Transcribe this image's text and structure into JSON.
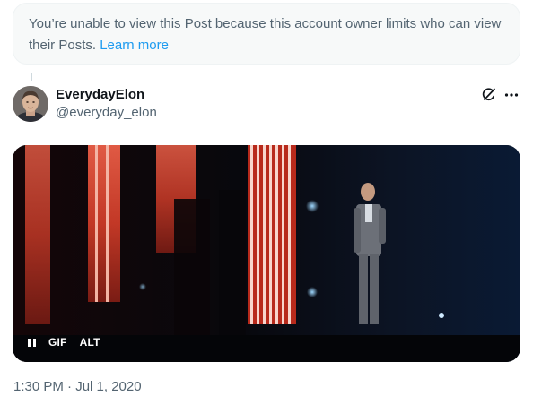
{
  "notice": {
    "text": "You’re unable to view this Post because this account owner limits who can view their Posts.",
    "link": "Learn more"
  },
  "author": {
    "name": "EverydayElon",
    "handle": "@everyday_elon"
  },
  "icons": {
    "grok": "grok-icon",
    "more": "more-options-icon",
    "pause": "pause-icon"
  },
  "media": {
    "gif_label": "GIF",
    "alt_label": "ALT"
  },
  "timestamp": "1:30 PM · Jul 1, 2020",
  "colors": {
    "accent": "#1d9bf0",
    "secondary_text": "#536471",
    "primary_text": "#0f1419",
    "notice_bg": "#f7f9f9"
  }
}
